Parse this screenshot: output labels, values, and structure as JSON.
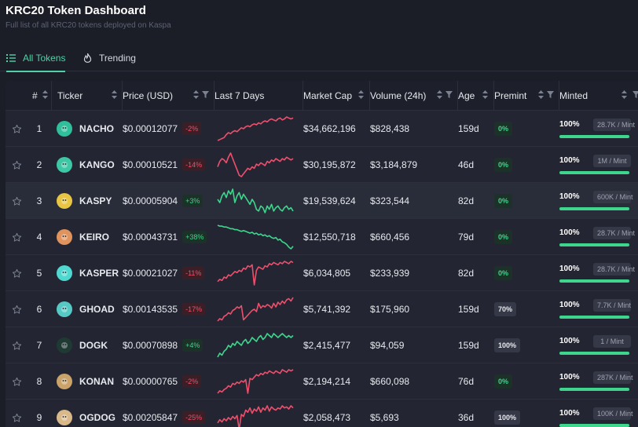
{
  "header": {
    "title": "KRC20 Token Dashboard",
    "subtitle": "Full list of all KRC20 tokens deployed on Kaspa"
  },
  "tabs": [
    {
      "label": "All Tokens",
      "icon": "list-icon",
      "active": true
    },
    {
      "label": "Trending",
      "icon": "flame-icon",
      "active": false
    }
  ],
  "columns": {
    "index": "#",
    "ticker": "Ticker",
    "price": "Price (USD)",
    "last7": "Last 7 Days",
    "mcap": "Market Cap",
    "volume": "Volume (24h)",
    "age": "Age",
    "premint": "Premint",
    "minted": "Minted"
  },
  "colors": {
    "positive": "#3dd68c",
    "negative": "#ef4f6c",
    "accent": "#4fd1a9"
  },
  "rows": [
    {
      "rank": "1",
      "ticker": "NACHO",
      "price": "$0.00012077",
      "change": "-2%",
      "dir": "neg",
      "mcap": "$34,662,196",
      "volume": "$828,438",
      "age": "159d",
      "premint": "0%",
      "minted_pct": "100%",
      "mint_size": "28.7K / Mint",
      "logo": "nacho-logo-icon",
      "logo_color": "#2fbf9a"
    },
    {
      "rank": "2",
      "ticker": "KANGO",
      "price": "$0.00010521",
      "change": "-14%",
      "dir": "neg",
      "mcap": "$30,195,872",
      "volume": "$3,184,879",
      "age": "46d",
      "premint": "0%",
      "minted_pct": "100%",
      "mint_size": "1M / Mint",
      "logo": "kango-logo-icon",
      "logo_color": "#3ec7a4"
    },
    {
      "rank": "3",
      "ticker": "KASPY",
      "price": "$0.00005904",
      "change": "+3%",
      "dir": "pos",
      "mcap": "$19,539,624",
      "volume": "$323,544",
      "age": "82d",
      "premint": "0%",
      "minted_pct": "100%",
      "mint_size": "600K / Mint",
      "logo": "kaspy-logo-icon",
      "logo_color": "#e8c542"
    },
    {
      "rank": "4",
      "ticker": "KEIRO",
      "price": "$0.00043731",
      "change": "+38%",
      "dir": "pos",
      "mcap": "$12,550,718",
      "volume": "$660,456",
      "age": "79d",
      "premint": "0%",
      "minted_pct": "100%",
      "mint_size": "28.7K / Mint",
      "logo": "keiro-logo-icon",
      "logo_color": "#e0935c"
    },
    {
      "rank": "5",
      "ticker": "KASPER",
      "price": "$0.00021027",
      "change": "-11%",
      "dir": "neg",
      "mcap": "$6,034,805",
      "volume": "$233,939",
      "age": "82d",
      "premint": "0%",
      "minted_pct": "100%",
      "mint_size": "28.7K / Mint",
      "logo": "kasper-logo-icon",
      "logo_color": "#4fd8d0"
    },
    {
      "rank": "6",
      "ticker": "GHOAD",
      "price": "$0.00143535",
      "change": "-17%",
      "dir": "neg",
      "mcap": "$5,741,392",
      "volume": "$175,960",
      "age": "159d",
      "premint": "70%",
      "minted_pct": "100%",
      "mint_size": "7.7K / Mint",
      "logo": "ghoad-logo-icon",
      "logo_color": "#56c9c4"
    },
    {
      "rank": "7",
      "ticker": "DOGK",
      "price": "$0.00070898",
      "change": "+4%",
      "dir": "pos",
      "mcap": "$2,415,477",
      "volume": "$94,059",
      "age": "159d",
      "premint": "100%",
      "minted_pct": "100%",
      "mint_size": "1 / Mint",
      "logo": "dogk-logo-icon",
      "logo_color": "#1f3a33"
    },
    {
      "rank": "8",
      "ticker": "KONAN",
      "price": "$0.00000765",
      "change": "-2%",
      "dir": "neg",
      "mcap": "$2,194,214",
      "volume": "$660,098",
      "age": "76d",
      "premint": "0%",
      "minted_pct": "100%",
      "mint_size": "287K / Mint",
      "logo": "konan-logo-icon",
      "logo_color": "#c9a36a"
    },
    {
      "rank": "9",
      "ticker": "OGDOG",
      "price": "$0.00205847",
      "change": "-25%",
      "dir": "neg",
      "mcap": "$2,058,473",
      "volume": "$5,693",
      "age": "36d",
      "premint": "100%",
      "minted_pct": "100%",
      "mint_size": "100K / Mint",
      "logo": "ogdog-logo-icon",
      "logo_color": "#d9b98a"
    }
  ]
}
